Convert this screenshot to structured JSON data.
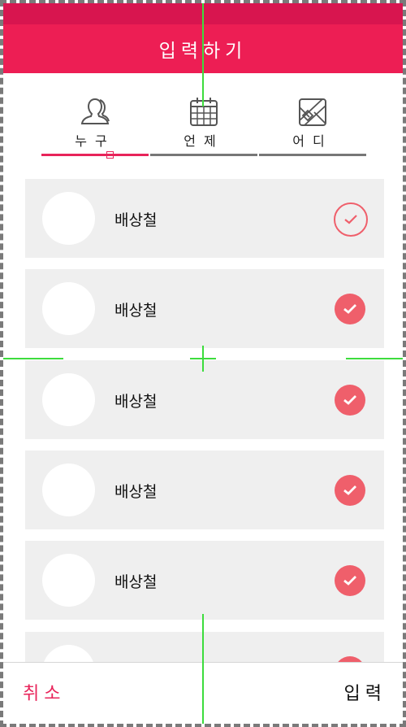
{
  "header": {
    "title": "입력하기"
  },
  "tabs": [
    {
      "label": "누구",
      "icon": "person-icon",
      "active": true
    },
    {
      "label": "언제",
      "icon": "calendar-icon",
      "active": false
    },
    {
      "label": "어디",
      "icon": "map-icon",
      "active": false
    }
  ],
  "people": [
    {
      "name": "배상철",
      "check": "unselected"
    },
    {
      "name": "배상철",
      "check": "selected"
    },
    {
      "name": "배상철",
      "check": "selected"
    },
    {
      "name": "배상철",
      "check": "selected"
    },
    {
      "name": "배상철",
      "check": "selected"
    },
    {
      "name": "",
      "check": "selected"
    }
  ],
  "footer": {
    "cancel_label": "취소",
    "submit_label": "입력"
  },
  "colors": {
    "status_bar": "#d8154f",
    "header": "#ed1e54",
    "accent": "#e8245a",
    "check": "#ef5f6b",
    "row_bg": "#efefef"
  }
}
